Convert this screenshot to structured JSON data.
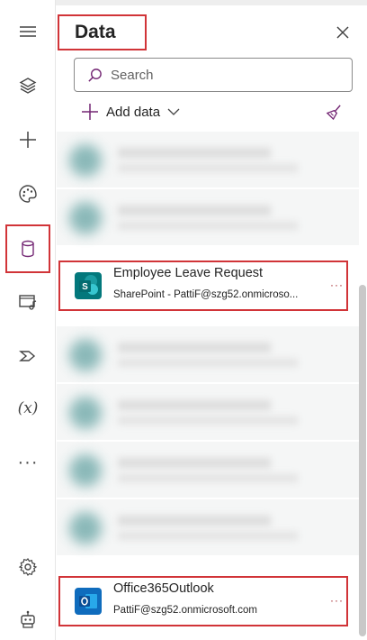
{
  "rail": {
    "items": [
      {
        "name": "menu",
        "icon": "hamburger-icon"
      },
      {
        "name": "tree-view",
        "icon": "layers-icon"
      },
      {
        "name": "insert",
        "icon": "plus-icon"
      },
      {
        "name": "theme",
        "icon": "palette-icon"
      },
      {
        "name": "data",
        "icon": "database-icon",
        "active": true
      },
      {
        "name": "media",
        "icon": "media-icon"
      },
      {
        "name": "power-automate",
        "icon": "flow-icon"
      },
      {
        "name": "variables",
        "icon": "variables-icon",
        "text": "(x)"
      },
      {
        "name": "more",
        "icon": "ellipsis-icon",
        "text": "···"
      },
      {
        "name": "settings",
        "icon": "gear-icon"
      },
      {
        "name": "copilot",
        "icon": "bot-icon"
      }
    ]
  },
  "panel": {
    "title": "Data",
    "close_icon": "close-icon",
    "search": {
      "placeholder": "Search"
    },
    "add_data_label": "Add data",
    "connections": [
      {
        "name": "Employee Leave Request",
        "subtitle": "SharePoint - PattiF@szg52.onmicroso...",
        "icon": "sharepoint-icon",
        "color": "#03787c"
      },
      {
        "name": "Office365Outlook",
        "subtitle": "PattiF@szg52.onmicrosoft.com",
        "icon": "outlook-icon",
        "color": "#0f6cbd"
      }
    ],
    "more_label": "···"
  },
  "colors": {
    "highlight": "#d13438",
    "accent": "#742774"
  }
}
